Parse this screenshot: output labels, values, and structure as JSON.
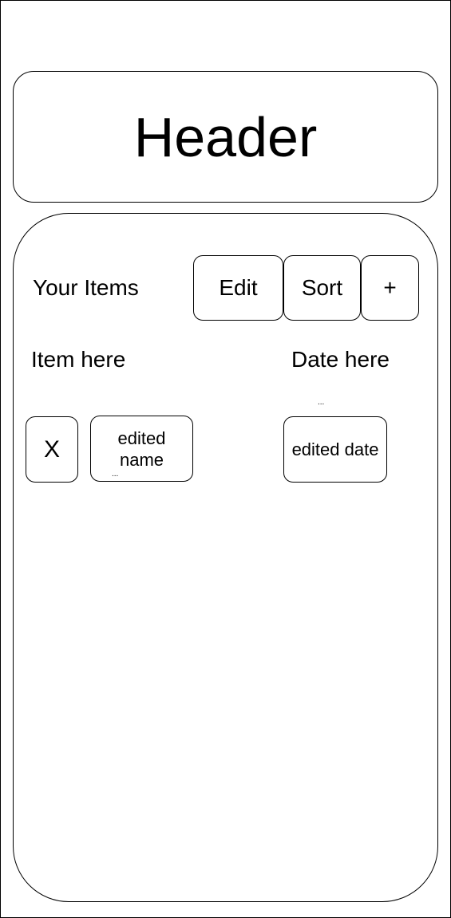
{
  "header": {
    "title": "Header"
  },
  "main": {
    "section_title": "Your Items",
    "toolbar": {
      "edit_label": "Edit",
      "sort_label": "Sort",
      "add_label": "+"
    },
    "columns": {
      "item": "Item here",
      "date": "Date here"
    },
    "row": {
      "delete_label": "X",
      "name_value": "edited name",
      "name_ellipsis": "...",
      "date_value": "edited date",
      "date_ellipsis": "..."
    }
  }
}
